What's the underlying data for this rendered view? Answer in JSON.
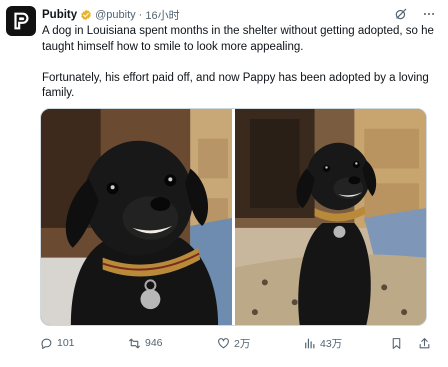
{
  "author": {
    "name": "Pubity",
    "handle": "@pubity",
    "separator": "·",
    "time": "16小时",
    "verified_badge_icon": "gold-verified-badge-icon",
    "avatar_icon": "pubity-logo-icon"
  },
  "tweet": {
    "paragraphs": [
      "A dog in Louisiana spent months in the shelter without getting adopted, so he taught himself how to smile to look more appealing.",
      "Fortunately, his effort paid off, and now Pappy has been adopted by a loving family."
    ]
  },
  "top_actions": [
    "grok-icon",
    "more-icon"
  ],
  "metrics": {
    "replies": "101",
    "retweets": "946",
    "likes": "2万",
    "views": "43万"
  },
  "colors": {
    "text": "#0f1419",
    "secondary": "#536471",
    "border": "#cfd9de",
    "badge": "#e8b22d"
  }
}
